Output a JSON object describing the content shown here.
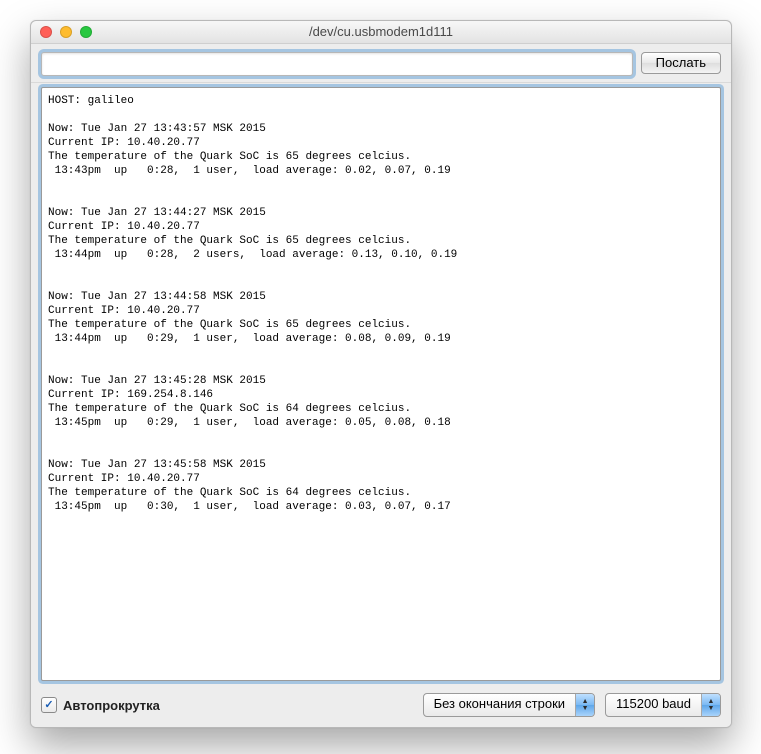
{
  "window": {
    "title": "/dev/cu.usbmodem1d111"
  },
  "toolbar": {
    "input_value": "",
    "send_label": "Послать"
  },
  "console": {
    "host_line": "HOST: galileo",
    "entries": [
      {
        "now": "Now: Tue Jan 27 13:43:57 MSK 2015",
        "ip": "Current IP: 10.40.20.77",
        "temp": "The temperature of the Quark SoC is 65 degrees celcius.",
        "uptime": " 13:43pm  up   0:28,  1 user,  load average: 0.02, 0.07, 0.19"
      },
      {
        "now": "Now: Tue Jan 27 13:44:27 MSK 2015",
        "ip": "Current IP: 10.40.20.77",
        "temp": "The temperature of the Quark SoC is 65 degrees celcius.",
        "uptime": " 13:44pm  up   0:28,  2 users,  load average: 0.13, 0.10, 0.19"
      },
      {
        "now": "Now: Tue Jan 27 13:44:58 MSK 2015",
        "ip": "Current IP: 10.40.20.77",
        "temp": "The temperature of the Quark SoC is 65 degrees celcius.",
        "uptime": " 13:44pm  up   0:29,  1 user,  load average: 0.08, 0.09, 0.19"
      },
      {
        "now": "Now: Tue Jan 27 13:45:28 MSK 2015",
        "ip": "Current IP: 169.254.8.146",
        "temp": "The temperature of the Quark SoC is 64 degrees celcius.",
        "uptime": " 13:45pm  up   0:29,  1 user,  load average: 0.05, 0.08, 0.18"
      },
      {
        "now": "Now: Tue Jan 27 13:45:58 MSK 2015",
        "ip": "Current IP: 10.40.20.77",
        "temp": "The temperature of the Quark SoC is 64 degrees celcius.",
        "uptime": " 13:45pm  up   0:30,  1 user,  load average: 0.03, 0.07, 0.17"
      }
    ]
  },
  "bottom": {
    "autoscroll_label": "Автопрокрутка",
    "autoscroll_checked": true,
    "line_ending_label": "Без окончания строки",
    "baud_label": "115200 baud"
  }
}
